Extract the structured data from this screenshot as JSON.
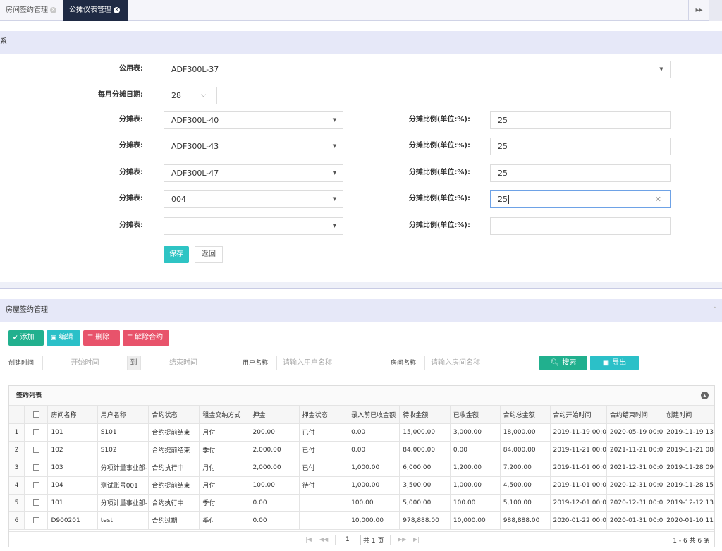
{
  "tabs": [
    {
      "label": "房间签约管理"
    },
    {
      "label": "公摊仪表管理"
    }
  ],
  "icons": {
    "tab_close": "close-circle-icon",
    "tab_scroll": "double-chevron-right-icon",
    "collapse": "chevron-up-icon"
  },
  "form_section": {
    "title": "关系",
    "public_meter_label": "公用表:",
    "public_meter_value": "ADF300L-37",
    "day_label": "每月分摊日期:",
    "day_value": "28",
    "rows": [
      {
        "meter_label": "分摊表:",
        "meter_value": "ADF300L-40",
        "ratio_label": "分摊比例(单位:%):",
        "ratio_value": "25"
      },
      {
        "meter_label": "分摊表:",
        "meter_value": "ADF300L-43",
        "ratio_label": "分摊比例(单位:%):",
        "ratio_value": "25"
      },
      {
        "meter_label": "分摊表:",
        "meter_value": "ADF300L-47",
        "ratio_label": "分摊比例(单位:%):",
        "ratio_value": "25"
      },
      {
        "meter_label": "分摊表:",
        "meter_value": "004",
        "ratio_label": "分摊比例(单位:%):",
        "ratio_value": "25"
      },
      {
        "meter_label": "分摊表:",
        "meter_value": "",
        "ratio_label": "分摊比例(单位:%):",
        "ratio_value": ""
      }
    ],
    "save_label": "保存",
    "back_label": "返回"
  },
  "contract_section": {
    "title": "房屋签约管理",
    "toolbar": {
      "add": "添加",
      "edit": "编辑",
      "delete": "删除",
      "terminate": "解除合约"
    },
    "filters": {
      "created_label": "创建时间:",
      "start_placeholder": "开始时间",
      "to_label": "到",
      "end_placeholder": "结束时间",
      "user_label": "用户名称:",
      "user_placeholder": "请输入用户名称",
      "room_label": "房间名称:",
      "room_placeholder": "请输入房间名称",
      "search": "搜索",
      "export": "导出"
    },
    "grid": {
      "title": "签约列表",
      "columns": [
        "房间名称",
        "用户名称",
        "合约状态",
        "租金交纳方式",
        "押金",
        "押金状态",
        "录入前已收金额",
        "待收金额",
        "已收金额",
        "合约总金额",
        "合约开始时间",
        "合约结束时间",
        "创建时间"
      ],
      "rows": [
        [
          "1",
          "101",
          "S101",
          "合约提前结束",
          "月付",
          "200.00",
          "已付",
          "0.00",
          "15,000.00",
          "3,000.00",
          "18,000.00",
          "2019-11-19 00:0",
          "2020-05-19 00:0",
          "2019-11-19 13"
        ],
        [
          "2",
          "102",
          "S102",
          "合约提前结束",
          "季付",
          "2,000.00",
          "已付",
          "0.00",
          "84,000.00",
          "0.00",
          "84,000.00",
          "2019-11-21 00:0",
          "2021-11-21 00:0",
          "2019-11-21 08"
        ],
        [
          "3",
          "103",
          "分项计量事业部-",
          "合约执行中",
          "月付",
          "2,000.00",
          "已付",
          "1,000.00",
          "6,000.00",
          "1,200.00",
          "7,200.00",
          "2019-11-01 00:0",
          "2021-12-31 00:0",
          "2019-11-28 09"
        ],
        [
          "4",
          "104",
          "测试账号001",
          "合约提前结束",
          "月付",
          "100.00",
          "待付",
          "1,000.00",
          "3,500.00",
          "1,000.00",
          "4,500.00",
          "2019-11-01 00:0",
          "2020-12-31 00:0",
          "2019-11-28 15"
        ],
        [
          "5",
          "101",
          "分项计量事业部-",
          "合约执行中",
          "季付",
          "0.00",
          "",
          "100.00",
          "5,000.00",
          "100.00",
          "5,100.00",
          "2019-12-01 00:0",
          "2020-12-31 00:0",
          "2019-12-12 13"
        ],
        [
          "6",
          "D900201",
          "test",
          "合约过期",
          "季付",
          "0.00",
          "",
          "10,000.00",
          "978,888.00",
          "10,000.00",
          "988,888.00",
          "2020-01-22 00:0",
          "2020-01-31 00:0",
          "2020-01-10 11"
        ]
      ]
    },
    "pager": {
      "page": "1",
      "total_pages": "共 1 页",
      "summary": "1 - 6  共 6 条"
    }
  }
}
